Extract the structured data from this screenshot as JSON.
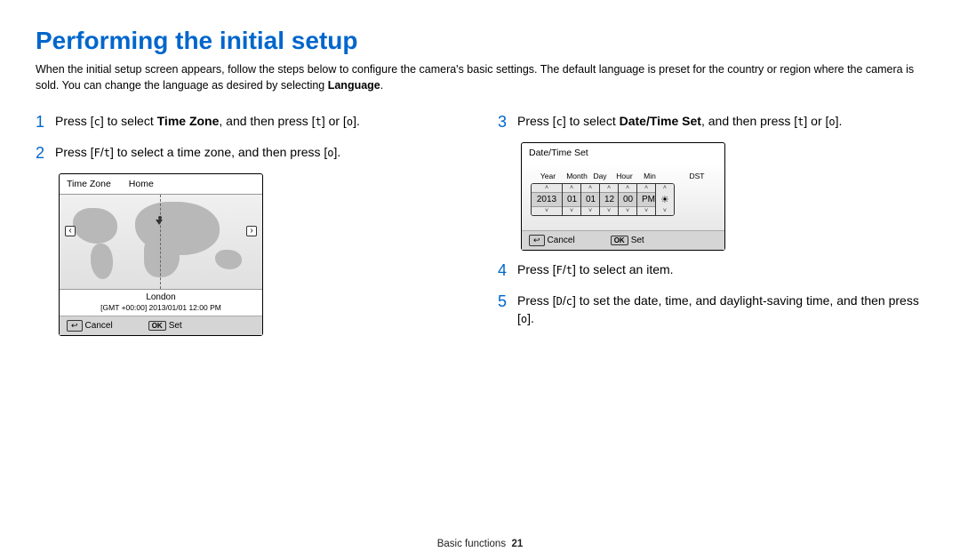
{
  "title": "Performing the initial setup",
  "intro_a": "When the initial setup screen appears, follow the steps below to configure the camera's basic settings. The default language is preset for the country or region where the camera is sold. You can change the language as desired by selecting ",
  "intro_bold": "Language",
  "intro_b": ".",
  "steps": {
    "s1": {
      "num": "1",
      "pre": "Press [",
      "k1": "c",
      "mid1": "] to select ",
      "bold": "Time Zone",
      "mid2": ", and then press [",
      "k2": "t",
      "mid3": "] or [",
      "k3": "o",
      "end": "]."
    },
    "s2": {
      "num": "2",
      "pre": "Press [",
      "k1": "F",
      "slash": "/",
      "k2": "t",
      "mid": "] to select a time zone, and then press [",
      "k3": "o",
      "end": "]."
    },
    "s3": {
      "num": "3",
      "pre": "Press [",
      "k1": "c",
      "mid1": "] to select ",
      "bold": "Date/Time Set",
      "mid2": ", and then press [",
      "k2": "t",
      "mid3": "] or [",
      "k3": "o",
      "end": "]."
    },
    "s4": {
      "num": "4",
      "pre": "Press [",
      "k1": "F",
      "slash": "/",
      "k2": "t",
      "end": "] to select an item."
    },
    "s5": {
      "num": "5",
      "pre": "Press [",
      "k1": "D",
      "slash": "/",
      "k2": "c",
      "mid": "] to set the date, time, and daylight-saving time, and then press [",
      "k3": "o",
      "end": "]."
    }
  },
  "tz_screen": {
    "label": "Time Zone",
    "mode": "Home",
    "city": "London",
    "gmt": "[GMT +00:00] 2013/01/01 12:00 PM",
    "cancel": "Cancel",
    "set": "Set",
    "ok": "OK"
  },
  "dt_screen": {
    "title": "Date/Time Set",
    "lbl_year": "Year",
    "lbl_month": "Month",
    "lbl_day": "Day",
    "lbl_hour": "Hour",
    "lbl_min": "Min",
    "lbl_dst": "DST",
    "year": "2013",
    "month": "01",
    "day": "01",
    "hour": "12",
    "min": "00",
    "ampm": "PM",
    "cancel": "Cancel",
    "set": "Set",
    "ok": "OK"
  },
  "footer": {
    "section": "Basic functions",
    "page": "21"
  }
}
